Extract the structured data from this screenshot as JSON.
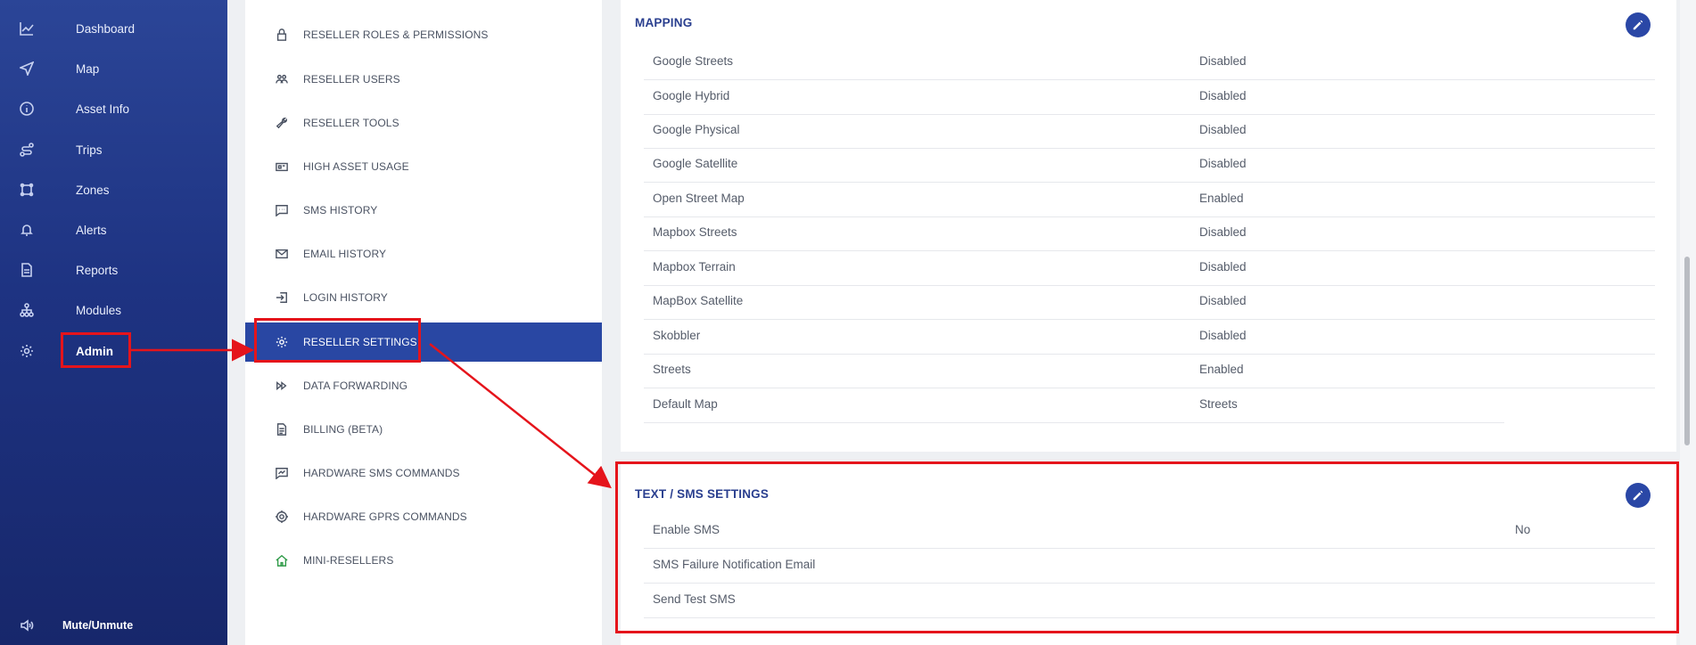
{
  "nav": {
    "items": [
      {
        "label": "Dashboard",
        "icon": "chart-line-icon"
      },
      {
        "label": "Map",
        "icon": "navigation-arrow-icon"
      },
      {
        "label": "Asset Info",
        "icon": "info-circle-icon"
      },
      {
        "label": "Trips",
        "icon": "route-icon"
      },
      {
        "label": "Zones",
        "icon": "zone-polygon-icon"
      },
      {
        "label": "Alerts",
        "icon": "bell-icon"
      },
      {
        "label": "Reports",
        "icon": "document-icon"
      },
      {
        "label": "Modules",
        "icon": "modules-tree-icon"
      },
      {
        "label": "Admin",
        "icon": "gear-icon"
      }
    ],
    "mute_label": "Mute/Unmute"
  },
  "submenu": {
    "items": [
      {
        "label": "RESELLER ROLES & PERMISSIONS",
        "icon": "lock-icon"
      },
      {
        "label": "RESELLER USERS",
        "icon": "users-icon"
      },
      {
        "label": "RESELLER TOOLS",
        "icon": "wrench-icon"
      },
      {
        "label": "HIGH ASSET USAGE",
        "icon": "sim-card-icon"
      },
      {
        "label": "SMS HISTORY",
        "icon": "chat-icon"
      },
      {
        "label": "EMAIL HISTORY",
        "icon": "envelope-icon"
      },
      {
        "label": "LOGIN HISTORY",
        "icon": "login-icon"
      },
      {
        "label": "RESELLER SETTINGS",
        "icon": "gear-icon"
      },
      {
        "label": "DATA FORWARDING",
        "icon": "fast-forward-icon"
      },
      {
        "label": "BILLING (BETA)",
        "icon": "invoice-icon"
      },
      {
        "label": "HARDWARE SMS COMMANDS",
        "icon": "sms-command-icon"
      },
      {
        "label": "HARDWARE GPRS COMMANDS",
        "icon": "target-icon"
      },
      {
        "label": "MINI-RESELLERS",
        "icon": "home-icon"
      }
    ]
  },
  "mapping": {
    "title": "MAPPING",
    "rows": [
      {
        "key": "Google Streets",
        "value": "Disabled"
      },
      {
        "key": "Google Hybrid",
        "value": "Disabled"
      },
      {
        "key": "Google Physical",
        "value": "Disabled"
      },
      {
        "key": "Google Satellite",
        "value": "Disabled"
      },
      {
        "key": "Open Street Map",
        "value": "Enabled"
      },
      {
        "key": "Mapbox Streets",
        "value": "Disabled"
      },
      {
        "key": "Mapbox Terrain",
        "value": "Disabled"
      },
      {
        "key": "MapBox Satellite",
        "value": "Disabled"
      },
      {
        "key": "Skobbler",
        "value": "Disabled"
      },
      {
        "key": "Streets",
        "value": "Enabled"
      },
      {
        "key": "Default Map",
        "value": "Streets"
      }
    ]
  },
  "sms": {
    "title": "TEXT / SMS SETTINGS",
    "rows": [
      {
        "key": "Enable SMS",
        "value": "No"
      },
      {
        "key": "SMS Failure Notification Email",
        "value": ""
      },
      {
        "key": "Send Test SMS",
        "value": ""
      }
    ]
  },
  "colors": {
    "nav_bg": "#1e3382",
    "active_bg": "#2947a3",
    "annotation": "#e5141b",
    "title": "#2a3f8f"
  }
}
